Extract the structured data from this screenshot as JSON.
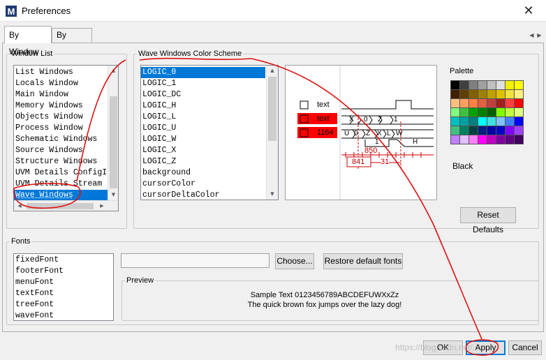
{
  "window": {
    "title": "Preferences",
    "close_glyph": "✕"
  },
  "tabs": [
    {
      "label": "By Window",
      "active": true
    },
    {
      "label": "By Name",
      "active": false
    }
  ],
  "window_list": {
    "legend": "Window List",
    "items": [
      "List Windows",
      "Locals Window",
      "Main Window",
      "Memory Windows",
      "Objects Window",
      "Process Window",
      "Schematic Windows",
      "Source Windows",
      "Structure Windows",
      "UVM Details ConfigI",
      "UVM Details Stream",
      "Wave Windows"
    ],
    "selected_index": 11
  },
  "color_scheme": {
    "legend": "Wave Windows Color Scheme",
    "items": [
      "LOGIC_0",
      "LOGIC_1",
      "LOGIC_DC",
      "LOGIC_H",
      "LOGIC_L",
      "LOGIC_U",
      "LOGIC_W",
      "LOGIC_X",
      "LOGIC_Z",
      "background",
      "cursorColor",
      "cursorDeltaColor"
    ],
    "selected_index": 0
  },
  "wave_preview": {
    "rows": [
      {
        "label": "text",
        "selected": false
      },
      {
        "label": "text",
        "selected": true
      },
      {
        "label": "1164",
        "selected": true
      }
    ],
    "signal_values": [
      "X",
      "0",
      "Z",
      "1",
      "U",
      "0",
      "Z",
      "X",
      "L",
      "W",
      "1",
      "H"
    ],
    "cursor_time": "850",
    "cursor_a": "841",
    "cursor_delta": "31"
  },
  "palette": {
    "legend": "Palette",
    "selected_name": "Black",
    "colors": [
      "#000000",
      "#404040",
      "#808080",
      "#a0a0a0",
      "#c0c0c0",
      "#e0e0e0",
      "#f0f000",
      "#ffff00",
      "#402000",
      "#604000",
      "#806000",
      "#a08000",
      "#c0a000",
      "#e0c000",
      "#f0e040",
      "#fff080",
      "#ffc080",
      "#ffa060",
      "#ff8040",
      "#e06040",
      "#c04040",
      "#a02020",
      "#ff4040",
      "#ff0000",
      "#80ff80",
      "#40c040",
      "#00a000",
      "#008000",
      "#006000",
      "#80ff00",
      "#c0ff40",
      "#e0ff80",
      "#00c0c0",
      "#00a0a0",
      "#008080",
      "#00ffff",
      "#40e0e0",
      "#80c0ff",
      "#4080ff",
      "#0000ff",
      "#40c080",
      "#008060",
      "#004040",
      "#002080",
      "#0000a0",
      "#0000c0",
      "#8000ff",
      "#a040ff",
      "#c080ff",
      "#e0c0ff",
      "#ff80ff",
      "#ff00ff",
      "#c000c0",
      "#8000a0",
      "#600080",
      "#400060"
    ],
    "reset_label": "Reset Defaults"
  },
  "fonts": {
    "legend": "Fonts",
    "items": [
      "fixedFont",
      "footerFont",
      "menuFont",
      "textFont",
      "treeFont",
      "waveFont"
    ],
    "font_field_value": "",
    "choose_label": "Choose...",
    "restore_label": "Restore default fonts",
    "preview_legend": "Preview",
    "sample_line1": "Sample Text 0123456789ABCDEFUWXxZz",
    "sample_line2": "The quick brown fox jumps over the lazy dog!"
  },
  "footer": {
    "ok_label": "OK",
    "apply_label": "Apply",
    "cancel_label": "Cancel"
  },
  "watermark": "https://blog.csdn.net/..."
}
